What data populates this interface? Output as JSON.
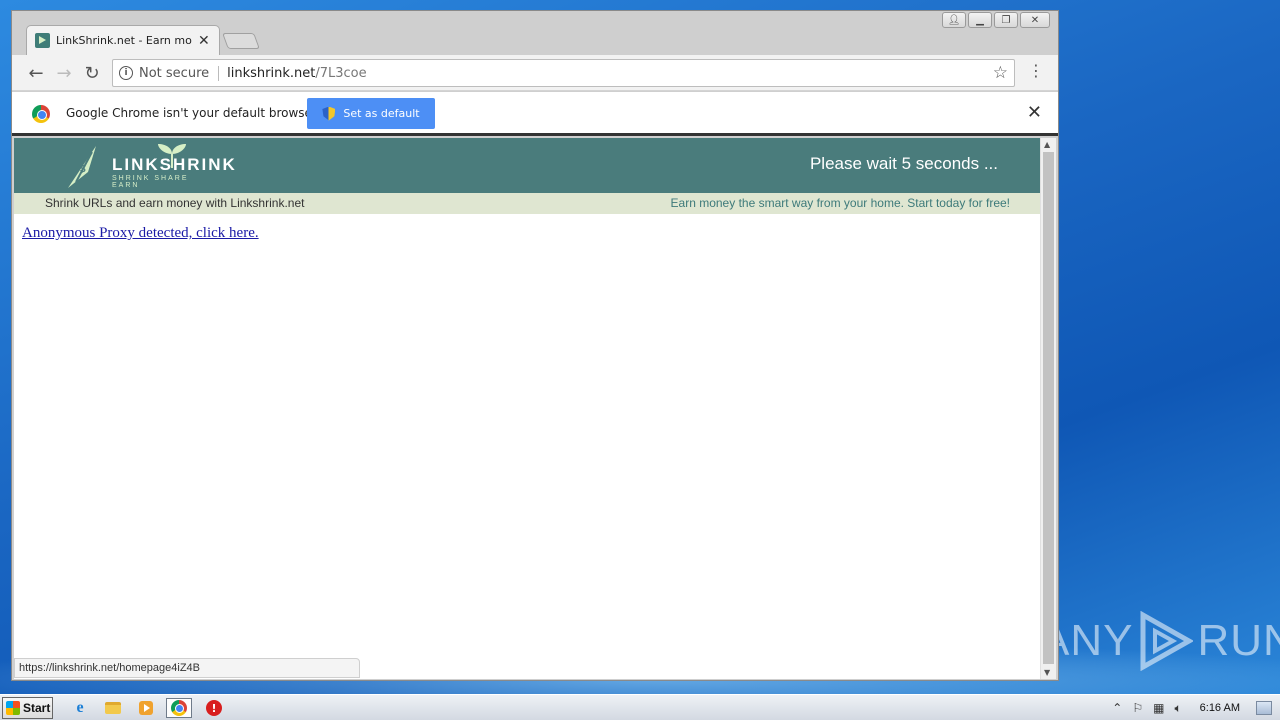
{
  "browser": {
    "tab_title": "LinkShrink.net - Earn money",
    "security_label": "Not secure",
    "url_host": "linkshrink.net",
    "url_path": "/7L3coe",
    "infobar_text": "Google Chrome isn't your default browser",
    "set_default_label": "Set as default",
    "status_url": "https://linkshrink.net/homepage4iZ4B"
  },
  "site": {
    "logo_text": "LINKSHRINK",
    "logo_sub": "SHRINK SHARE EARN",
    "wait_text": "Please wait 5 seconds ...",
    "tagline_left": "Shrink URLs and earn money with Linkshrink.net",
    "tagline_right": "Earn money the smart way from your home. Start today for free!",
    "proxy_link": "Anonymous Proxy detected, click here."
  },
  "taskbar": {
    "start_label": "Start",
    "clock": "6:16 AM"
  },
  "watermark": {
    "left": "ANY",
    "right": "RUN"
  },
  "colors": {
    "site_header": "#4a7c7c",
    "tagbar": "#dfe6d1",
    "set_default": "#4d8ff5",
    "link": "#1a1aa6"
  }
}
